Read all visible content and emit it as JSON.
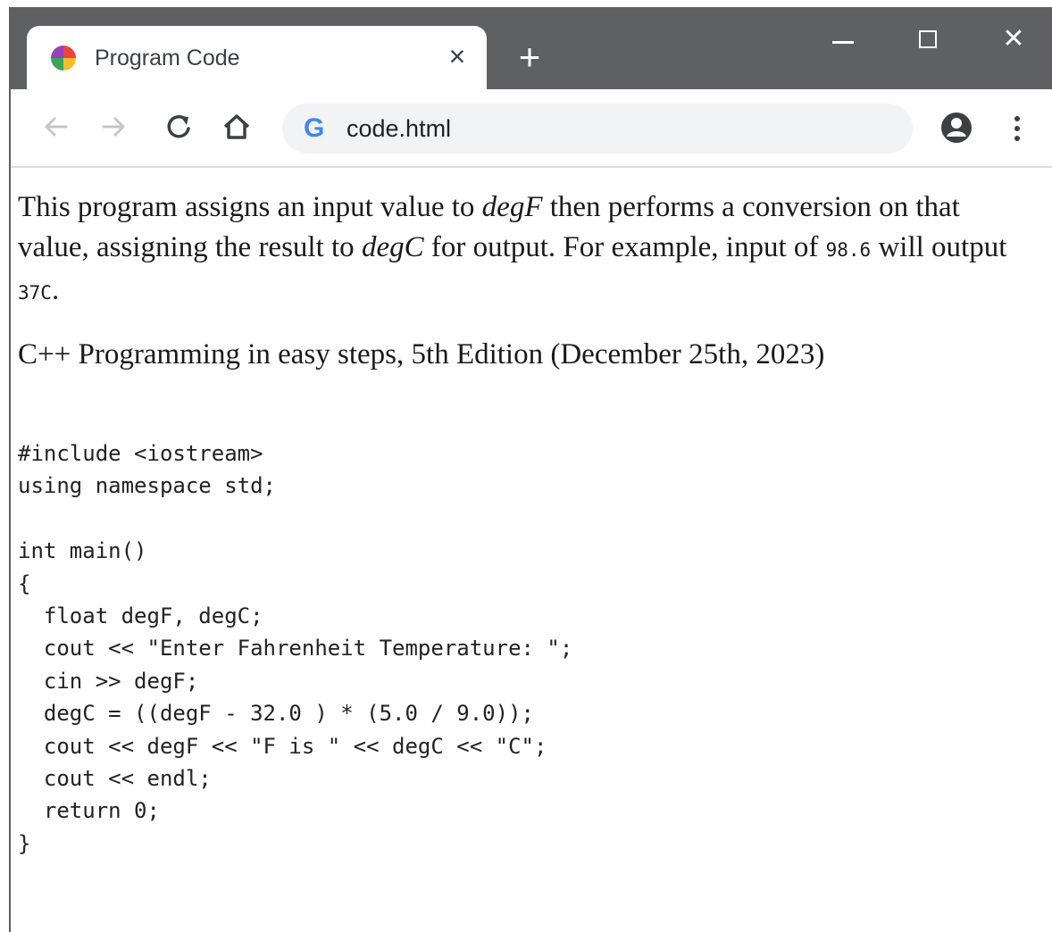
{
  "browser": {
    "tab_title": "Program Code",
    "url": "code.html",
    "omnibox_icon": "google-g-icon"
  },
  "page": {
    "intro_1": "This program assigns an input value to ",
    "var_f": "degF",
    "intro_2": " then performs a conversion on that value, assigning the result to ",
    "var_c": "degC",
    "intro_3": " for output. For example, input of ",
    "example_in": "98.6",
    "intro_4": " will output ",
    "example_out": "37C",
    "intro_5": ".",
    "credit": "C++ Programming in easy steps, 5th Edition (December 25th, 2023)",
    "code": [
      "#include <iostream>",
      "using namespace std;",
      "",
      "int main()",
      "{",
      "  float degF, degC;",
      "  cout << \"Enter Fahrenheit Temperature: \";",
      "  cin >> degF;",
      "  degC = ((degF - 32.0 ) * (5.0 / 9.0));",
      "  cout << degF << \"F is \" << degC << \"C\";",
      "  cout << endl;",
      "  return 0;",
      "}"
    ]
  },
  "colors": {
    "tabstrip": "#5f6063",
    "omnibox": "#f1f3f4",
    "google_blue": "#4285f4"
  }
}
